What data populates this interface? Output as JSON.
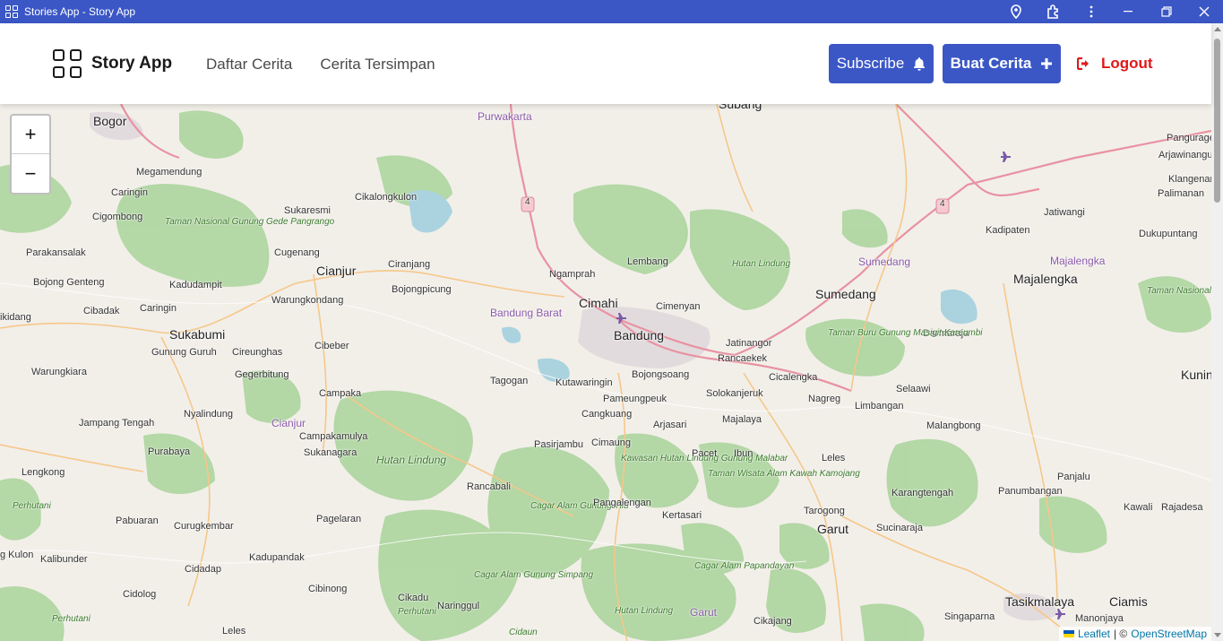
{
  "window": {
    "title": "Stories App - Story App"
  },
  "header": {
    "brand": "Story App",
    "nav": [
      "Daftar Cerita",
      "Cerita Tersimpan"
    ],
    "subscribe_label": "Subscribe",
    "create_label": "Buat Cerita",
    "logout_label": "Logout"
  },
  "map": {
    "zoom_in": "+",
    "zoom_out": "−",
    "attribution": {
      "leaflet": "Leaflet",
      "sep": "| ©",
      "osm": "OpenStreetMap"
    },
    "labels": {
      "bogor": "Bogor",
      "purwakarta": "Purwakarta",
      "subang": "Subang",
      "pangurage": "Pangurage",
      "arjawinangun": "Arjawinangun",
      "klangenan": "Klangenan",
      "palimanan": "Palimanan",
      "megamendung": "Megamendung",
      "caringin1": "Caringin",
      "cigombong": "Cigombong",
      "cikalongkulon": "Cikalongkulon",
      "sukaresmi": "Sukaresmi",
      "tnggp": "Taman Nasional Gunung Gede Pangrango",
      "parakansalak": "Parakansalak",
      "cugenang": "Cugenang",
      "cianjur": "Cianjur",
      "ciranjang": "Ciranjang",
      "ngamprah": "Ngamprah",
      "lembang": "Lembang",
      "hutan_lindung1": "Hutan Lindung",
      "sumedang_purple": "Sumedang",
      "majalengka_purple": "Majalengka",
      "kadipaten": "Kadipaten",
      "jatiwangi": "Jatiwangi",
      "dukupuntang": "Dukupuntang",
      "bojong_genteng": "Bojong Genteng",
      "kadudampit": "Kadudampit",
      "bojongpicung": "Bojongpicung",
      "warungkondang": "Warungkondang",
      "sumedang": "Sumedang",
      "majalengka": "Majalengka",
      "cibadak": "Cibadak",
      "caringin2": "Caringin",
      "bandung_barat": "Bandung Barat",
      "cimahi": "Cimahi",
      "cimenyan": "Cimenyan",
      "tn_ciremai": "Taman Nasional Gunung Ciremai",
      "kikidang": "ikidang",
      "sukabumi": "Sukabumi",
      "bandung": "Bandung",
      "jatinangor": "Jatinangor",
      "darmaraja": "Darmaraja",
      "gunung_guruh": "Gunung Guruh",
      "cireunghas": "Cireunghas",
      "cibeber": "Cibeber",
      "rancaekek": "Rancaekek",
      "tahura_masigit": "Taman Buru Gunung Masigit Kareumbi",
      "warungkiara": "Warungkiara",
      "gegerbitung": "Gegerbitung",
      "tagogan": "Tagogan",
      "kutawaringin": "Kutawaringin",
      "bojongsoang": "Bojongsoang",
      "cicalengka": "Cicalengka",
      "kuningan": "Kunin",
      "campaka": "Campaka",
      "pameungpeuk": "Pameungpeuk",
      "solokanjeruk": "Solokanjeruk",
      "nagreg": "Nagreg",
      "selaawi": "Selaawi",
      "limbangan": "Limbangan",
      "jampang_tengah": "Jampang Tengah",
      "nyalindung": "Nyalindung",
      "cianjur_purple": "Cianjur",
      "cangkuang": "Cangkuang",
      "arjasari": "Arjasari",
      "majalaya": "Majalaya",
      "malangbong": "Malangbong",
      "campakamulya": "Campakamulya",
      "pasirjambu": "Pasirjambu",
      "cimaung": "Cimaung",
      "purabaya": "Purabaya",
      "sukanagara": "Sukanagara",
      "hutan_lindung2": "Hutan Lindung",
      "kawasan_malabar": "Kawasan Hutan Lindung Gunung Malabar",
      "pacet": "Pacet",
      "ibun": "Ibun",
      "leles": "Leles",
      "lengkong": "Lengkong",
      "tw_kamojang": "Taman Wisata Alam Kawah Kamojang",
      "panjalu": "Panjalu",
      "rancabali": "Rancabali",
      "karangtengah": "Karangtengah",
      "panumbangan": "Panumbangan",
      "perhutani1": "Perhutani",
      "cagar_tilu": "Cagar Alam Gunung Tilu",
      "pangalengan": "Pangalengan",
      "tarogong": "Tarogong",
      "kawali": "Kawali",
      "rajadesa": "Rajadesa",
      "kertasari": "Kertasari",
      "pabuaran": "Pabuaran",
      "curugkembar": "Curugkembar",
      "pagelaran": "Pagelaran",
      "garut": "Garut",
      "sucinaraja": "Sucinaraja",
      "kulon": "g Kulon",
      "kalibunder": "Kalibunder",
      "kadupandak": "Kadupandak",
      "cagar_papandayan": "Cagar Alam Papandayan",
      "cidadap": "Cidadap",
      "cagar_simpang": "Cagar Alam Gunung Simpang",
      "cibinong": "Cibinong",
      "cidolog": "Cidolog",
      "cikadu": "Cikadu",
      "perhutani2": "Perhutani",
      "naringgul": "Naringgul",
      "tasikmalaya": "Tasikmalaya",
      "ciamis": "Ciamis",
      "hutan_lindung3": "Hutan Lindung",
      "garut_purple": "Garut",
      "singaparna": "Singaparna",
      "manonjaya": "Manonjaya",
      "perhutani3": "Perhutani",
      "cikajang": "Cikajang",
      "leles2": "Leles",
      "cidaun": "Cidaun",
      "road_4a": "4",
      "road_4b": "4"
    }
  }
}
